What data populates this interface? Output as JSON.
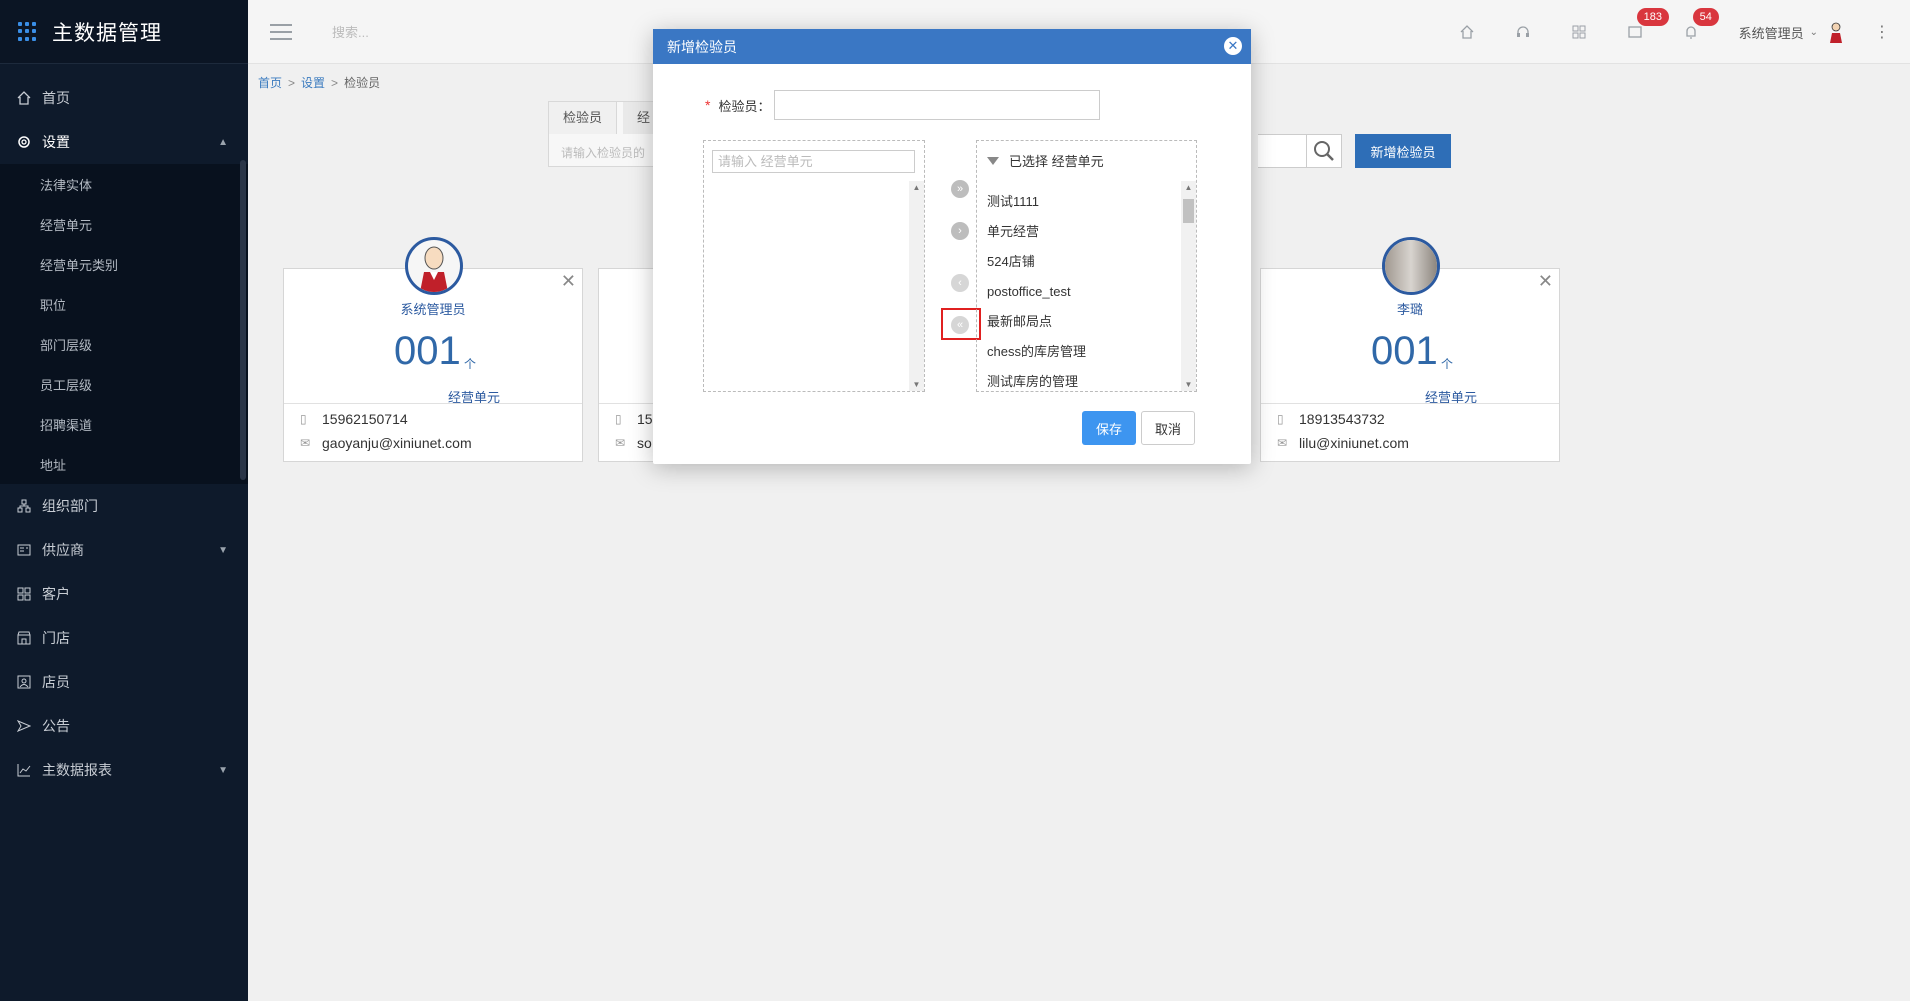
{
  "app": {
    "title": "主数据管理"
  },
  "sidebar": {
    "items": [
      {
        "label": "首页",
        "icon": "home-icon"
      },
      {
        "label": "设置",
        "icon": "gear-icon"
      },
      {
        "label": "组织部门",
        "icon": "org-icon"
      },
      {
        "label": "供应商",
        "icon": "supplier-icon"
      },
      {
        "label": "客户",
        "icon": "customer-icon"
      },
      {
        "label": "门店",
        "icon": "store-icon"
      },
      {
        "label": "店员",
        "icon": "staff-icon"
      },
      {
        "label": "公告",
        "icon": "announcement-icon"
      },
      {
        "label": "主数据报表",
        "icon": "report-icon"
      }
    ],
    "settings_sub": [
      "法律实体",
      "经营单元",
      "经营单元类别",
      "职位",
      "部门层级",
      "员工层级",
      "招聘渠道",
      "地址"
    ]
  },
  "topbar": {
    "search_placeholder": "搜索...",
    "badge_messages": "183",
    "badge_notifications": "54",
    "user": "系统管理员"
  },
  "breadcrumb": {
    "home": "首页",
    "settings": "设置",
    "current": "检验员"
  },
  "page": {
    "tab_active": "检验员",
    "tab_second": "经",
    "search_placeholder": "请输入检验员的",
    "add_button": "新增检验员"
  },
  "cards": [
    {
      "name": "系统管理员",
      "count": "001",
      "unit": "个",
      "unit_label": "经营单元",
      "phone": "15962150714",
      "email": "gaoyanju@xiniunet.com"
    },
    {
      "name": "",
      "count": "",
      "unit": "",
      "unit_label": "",
      "phone": "15",
      "email": "so"
    },
    {
      "name": "李璐",
      "count": "001",
      "unit": "个",
      "unit_label": "经营单元",
      "phone": "18913543732",
      "email": "lilu@xiniunet.com"
    }
  ],
  "modal": {
    "title": "新增检验员",
    "field_label": "检验员：",
    "left_search_placeholder": "请输入 经营单元",
    "right_header": "已选择 经营单元",
    "selected_items": [
      "测试1111",
      "单元经营",
      "524店铺",
      "postoffice_test",
      "最新邮局点",
      "chess的库房管理",
      "测试库房的管理"
    ],
    "save": "保存",
    "cancel": "取消"
  }
}
